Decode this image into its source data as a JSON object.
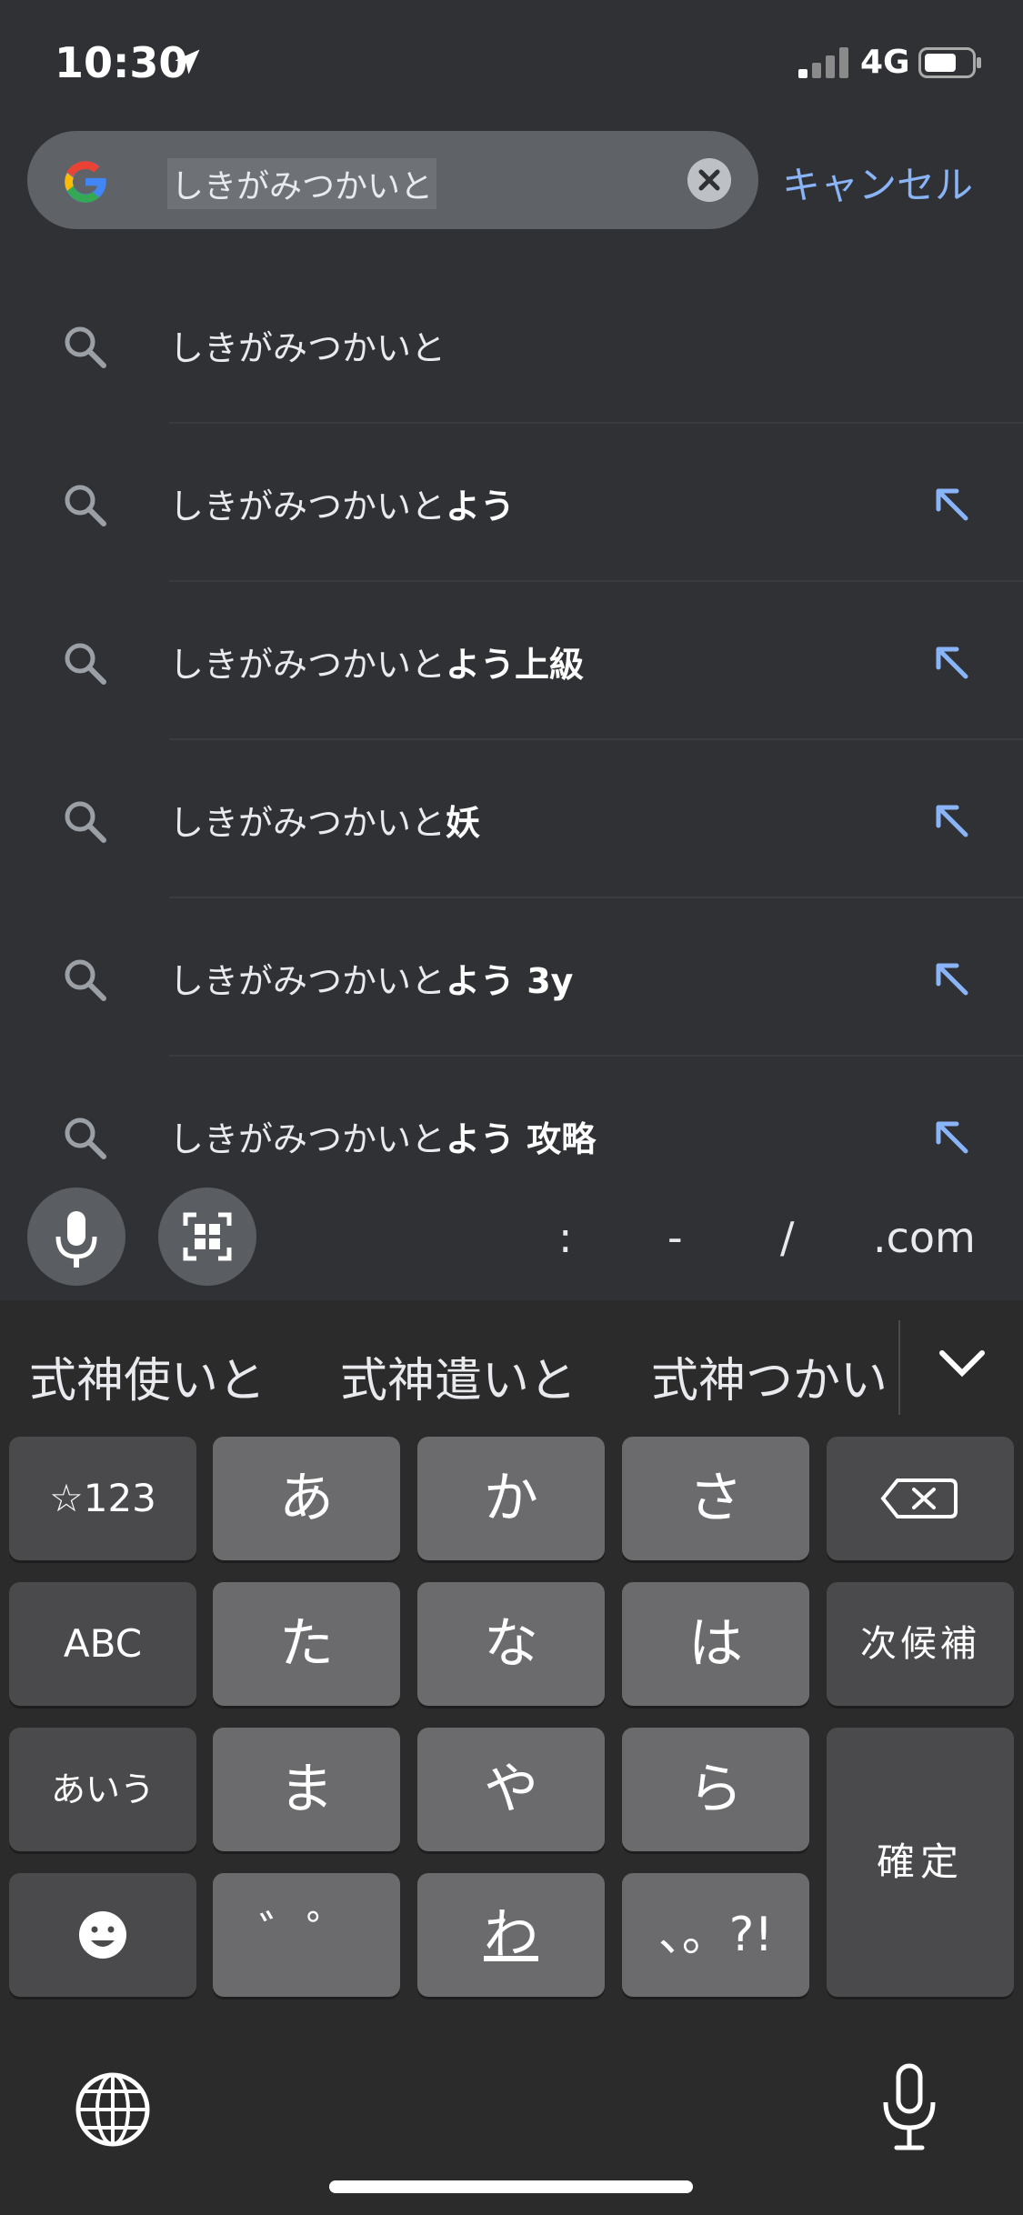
{
  "status_bar": {
    "time": "10:30",
    "network": "4G"
  },
  "search": {
    "query": "しきがみつかいと",
    "cancel_label": "キャンセル"
  },
  "suggestions": [
    {
      "prefix": "しきがみつかいと",
      "bold": ""
    },
    {
      "prefix": "しきがみつかいと",
      "bold": "よう"
    },
    {
      "prefix": "しきがみつかいと",
      "bold": "よう上級"
    },
    {
      "prefix": "しきがみつかいと",
      "bold": "妖"
    },
    {
      "prefix": "しきがみつかいと",
      "bold": "よう 3y"
    },
    {
      "prefix": "しきがみつかいと",
      "bold": "よう 攻略"
    }
  ],
  "accessory": {
    "colon": ":",
    "dash": "-",
    "slash": "/",
    "dotcom": ".com"
  },
  "keyboard": {
    "candidates": [
      "式神使いと",
      "式神遣いと",
      "式神つかい"
    ],
    "keys": {
      "sym": "☆123",
      "a": "あ",
      "ka": "か",
      "sa": "さ",
      "abc": "ABC",
      "ta": "た",
      "na": "な",
      "ha": "は",
      "next": "次候補",
      "aiu": "あいう",
      "ma": "ま",
      "ya": "や",
      "ra": "ら",
      "confirm": "確定",
      "dakuten": "゛゜",
      "wa": "わ",
      "punct": "、。?!"
    }
  },
  "colors": {
    "accent": "#8ab4f8",
    "background": "#303134"
  },
  "icons": [
    "location-arrow-icon",
    "signal-icon",
    "battery-icon",
    "google-logo",
    "clear-icon",
    "search-icon",
    "arrow-up-left-icon",
    "mic-icon",
    "qr-scan-icon",
    "backspace-icon",
    "emoji-icon",
    "globe-icon",
    "dictation-mic-icon",
    "chevron-down-icon"
  ]
}
